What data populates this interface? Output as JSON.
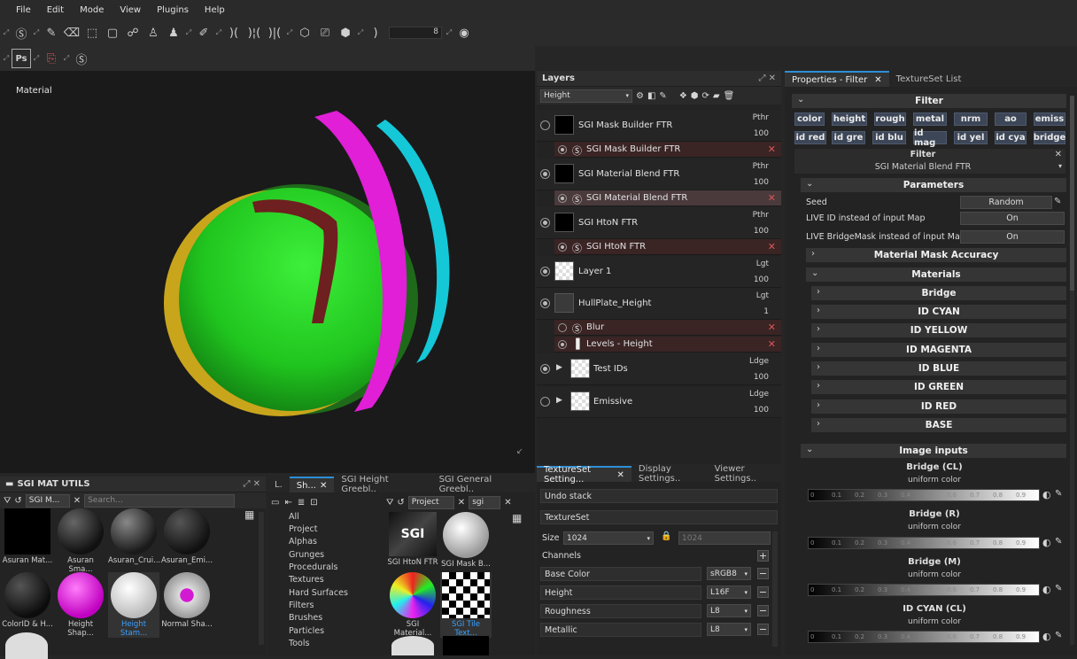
{
  "menu": [
    "File",
    "Edit",
    "Mode",
    "View",
    "Plugins",
    "Help"
  ],
  "toolbar": {
    "brush_size_value": "8"
  },
  "viewport": {
    "label": "Material"
  },
  "layers": {
    "title": "Layers",
    "channel_select": "Height",
    "rows": [
      {
        "name": "SGI Mask Builder FTR",
        "blend": "Pthr",
        "opacity": "100",
        "sub": [
          {
            "name": "SGI Mask Builder FTR"
          }
        ]
      },
      {
        "name": "SGI Material Blend FTR",
        "blend": "Pthr",
        "opacity": "100",
        "sub": [
          {
            "name": "SGI Material Blend FTR"
          }
        ]
      },
      {
        "name": "SGI HtoN FTR",
        "blend": "Pthr",
        "opacity": "100",
        "sub": [
          {
            "name": "SGI HtoN FTR"
          }
        ]
      },
      {
        "name": "Layer 1",
        "blend": "Lgt",
        "opacity": "100"
      },
      {
        "name": "HullPlate_Height",
        "blend": "Lgt",
        "opacity": "1",
        "sub": [
          {
            "name": "Blur"
          },
          {
            "name": "Levels - Height"
          }
        ]
      },
      {
        "name": "Test IDs",
        "blend": "Ldge",
        "opacity": "100"
      },
      {
        "name": "Emissive",
        "blend": "Ldge",
        "opacity": "100"
      }
    ]
  },
  "props": {
    "tabs": [
      "Properties - Filter",
      "TextureSet List"
    ],
    "filter_header": "Filter",
    "chips_row1": [
      "color",
      "height",
      "rough",
      "metal",
      "nrm",
      "ao",
      "emiss"
    ],
    "chips_row2": [
      "id red",
      "id gre",
      "id blu",
      "id mag",
      "id yel",
      "id cya",
      "bridge"
    ],
    "filter_label": "Filter",
    "filter_name": "SGI Material Blend FTR",
    "parameters": "Parameters",
    "seed_label": "Seed",
    "seed_value": "Random",
    "live_id_label": "LIVE ID instead of input Map",
    "live_id_value": "On",
    "live_bridge_label": "LIVE BridgeMask instead of input  Map",
    "live_bridge_value": "On",
    "mask_accuracy": "Material Mask Accuracy",
    "materials": "Materials",
    "material_items": [
      "Bridge",
      "ID CYAN",
      "ID YELLOW",
      "ID MAGENTA",
      "ID BLUE",
      "ID GREEN",
      "ID RED",
      "BASE"
    ],
    "image_inputs": "Image inputs",
    "inputs": [
      {
        "title": "Bridge (CL)",
        "sub": "uniform color"
      },
      {
        "title": "Bridge (R)",
        "sub": "uniform color"
      },
      {
        "title": "Bridge (M)",
        "sub": "uniform color"
      },
      {
        "title": "ID CYAN (CL)",
        "sub": "uniform color"
      }
    ],
    "ticks": [
      "0",
      "0.1",
      "0.2",
      "0.3",
      "0.4",
      "0.5",
      "0.6",
      "0.7",
      "0.8",
      "0.9",
      "1"
    ]
  },
  "shelf": {
    "title": "SGI MAT UTILS",
    "tab": "SGI M...",
    "search_placeholder": "Search...",
    "items": [
      "Asuran Mat...",
      "Asuran Sma...",
      "Asuran_Crui...",
      "Asuran_Emi...",
      "ColorID & H...",
      "Height Shap...",
      "Height Stam...",
      "Normal Sha..."
    ]
  },
  "shelf2": {
    "tabs": [
      "L.",
      "Sh...",
      "SGI Height Greebl..",
      "SGI General Greebl.."
    ],
    "categories": [
      "All",
      "Project",
      "Alphas",
      "Grunges",
      "Procedurals",
      "Textures",
      "Hard Surfaces",
      "Filters",
      "Brushes",
      "Particles",
      "Tools"
    ],
    "filter_select": "Project",
    "search_value": "sgi",
    "items": [
      "SGI HtoN FTR",
      "SGI Mask B...",
      "SGI Material...",
      "SGI Tile Text..."
    ]
  },
  "textureset": {
    "tabs": [
      "TextureSet Setting...",
      "Display Settings..",
      "Viewer Settings.."
    ],
    "undo": "Undo stack",
    "textureset_label": "TextureSet",
    "size_label": "Size",
    "size_value": "1024",
    "size_value2": "1024",
    "channels_label": "Channels",
    "channels": [
      {
        "name": "Base Color",
        "format": "sRGB8"
      },
      {
        "name": "Height",
        "format": "L16F"
      },
      {
        "name": "Roughness",
        "format": "L8"
      },
      {
        "name": "Metallic",
        "format": "L8"
      }
    ]
  },
  "colors": {
    "accent": "#2d8fd6",
    "chip": "#3c4657",
    "layer_sub": "#3a2424"
  }
}
